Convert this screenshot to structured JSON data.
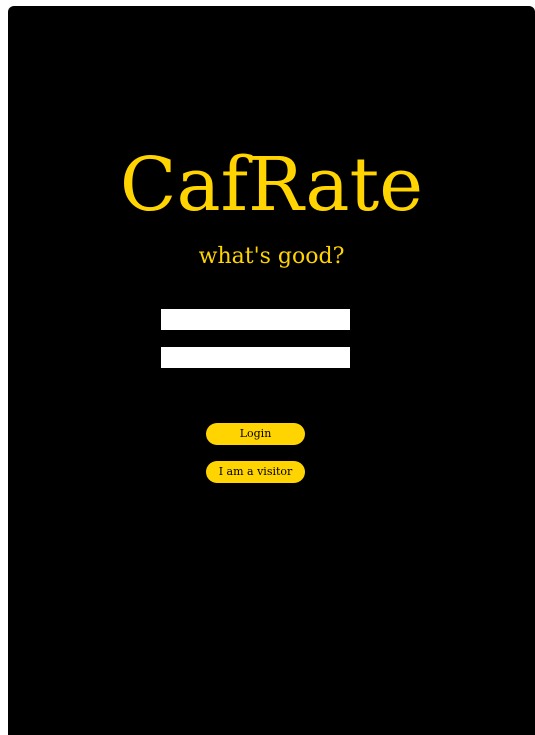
{
  "app": {
    "title": "CafRate",
    "tagline": "what's good?"
  },
  "form": {
    "username_value": "",
    "username_placeholder": "",
    "password_value": "",
    "password_placeholder": "",
    "login_label": "Login",
    "visitor_label": "I am a visitor"
  },
  "colors": {
    "background": "#000000",
    "accent": "#FFD400",
    "field": "#FFFFFF"
  }
}
